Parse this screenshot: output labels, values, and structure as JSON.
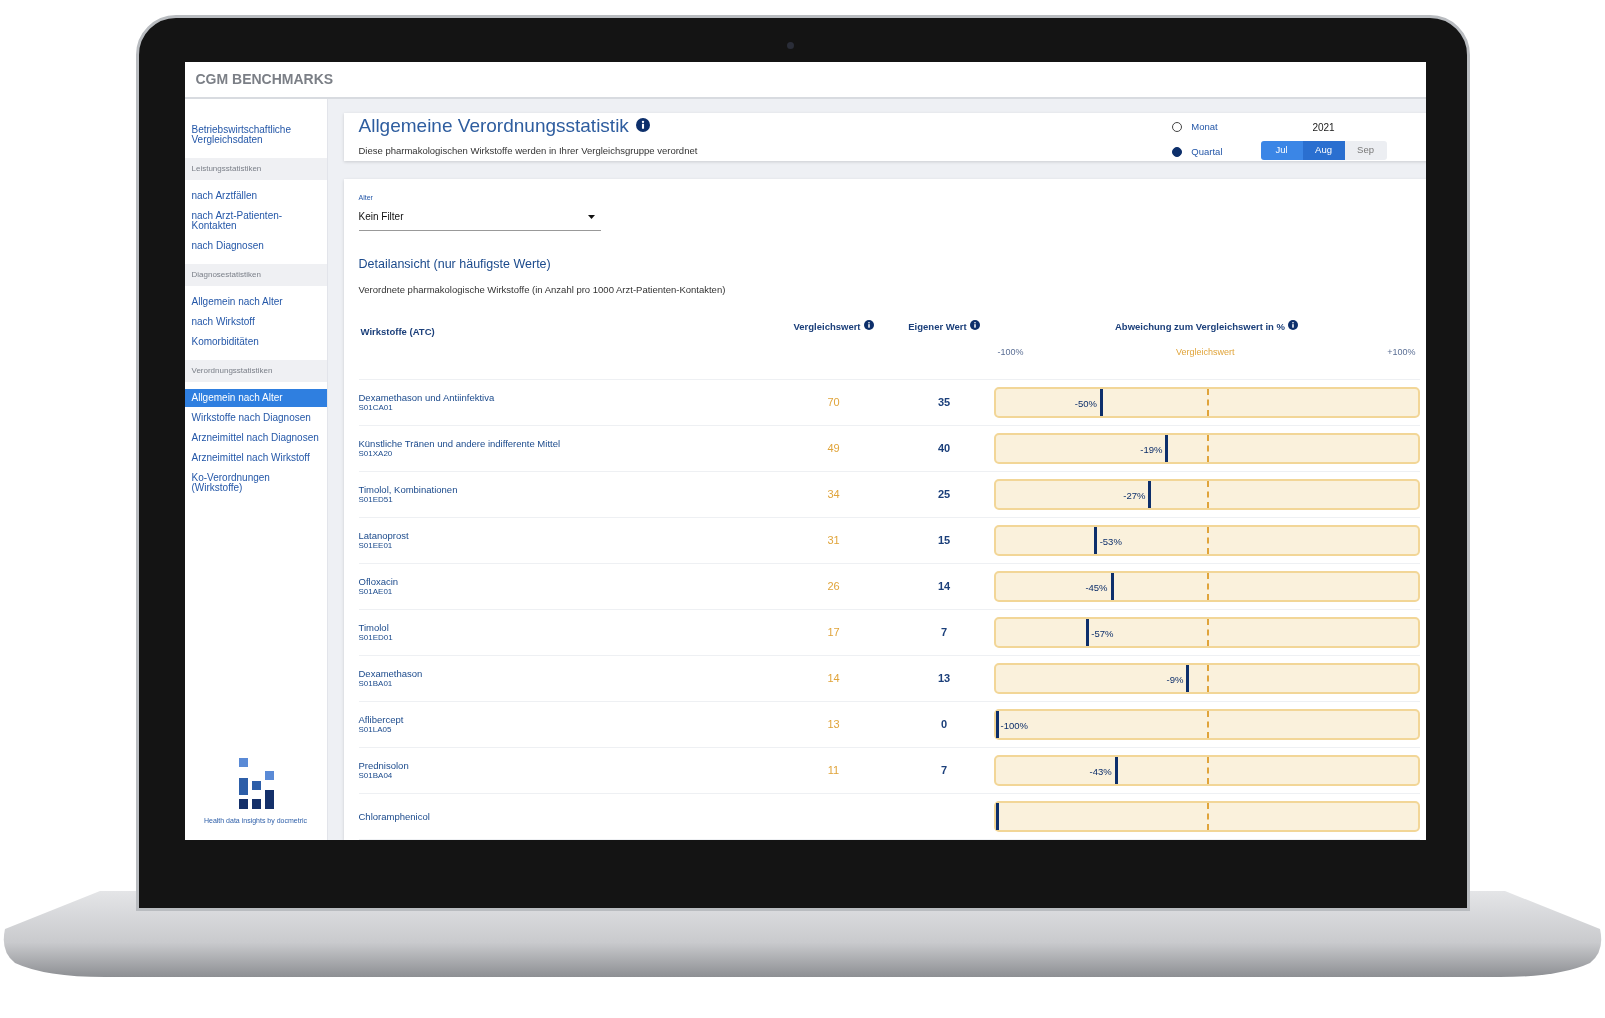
{
  "app": {
    "title": "CGM BENCHMARKS"
  },
  "sidebar": {
    "items": [
      {
        "kind": "link",
        "label": "Betriebswirtschaftliche Vergleichsdaten",
        "selected": false
      },
      {
        "kind": "section",
        "label": "Leistungsstatistiken"
      },
      {
        "kind": "link",
        "label": "nach Arztfällen",
        "selected": false
      },
      {
        "kind": "link",
        "label": "nach Arzt-Patienten-Kontakten",
        "selected": false
      },
      {
        "kind": "link",
        "label": "nach Diagnosen",
        "selected": false
      },
      {
        "kind": "section",
        "label": "Diagnosestatistiken"
      },
      {
        "kind": "link",
        "label": "Allgemein nach Alter",
        "selected": false
      },
      {
        "kind": "link",
        "label": "nach Wirkstoff",
        "selected": false
      },
      {
        "kind": "link",
        "label": "Komorbiditäten",
        "selected": false
      },
      {
        "kind": "section",
        "label": "Verordnungsstatistiken"
      },
      {
        "kind": "link",
        "label": "Allgemein nach Alter",
        "selected": true
      },
      {
        "kind": "link",
        "label": "Wirkstoffe nach Diagnosen",
        "selected": false
      },
      {
        "kind": "link",
        "label": "Arzneimittel nach Diagnosen",
        "selected": false
      },
      {
        "kind": "link",
        "label": "Arzneimittel nach Wirkstoff",
        "selected": false
      },
      {
        "kind": "link",
        "label": "Ko-Verordnungen (Wirkstoffe)",
        "selected": false
      }
    ],
    "footer": "Health data insights by docmetric"
  },
  "header": {
    "title": "Allgemeine Verordnungsstatistik",
    "subtitle": "Diese pharmakologischen Wirkstoffe werden in Ihrer Vergleichsgruppe verordnet",
    "period_options": [
      {
        "label": "Monat",
        "selected": false
      },
      {
        "label": "Quartal",
        "selected": true
      }
    ],
    "year": "2021",
    "months": [
      {
        "label": "Jul",
        "selected": true
      },
      {
        "label": "Aug",
        "selected": true
      },
      {
        "label": "Sep",
        "selected": false
      }
    ]
  },
  "filter": {
    "label": "Alter",
    "value": "Kein Filter"
  },
  "detail": {
    "title": "Detailansicht (nur häufigste Werte)",
    "subtitle": "Verordnete pharmakologische Wirkstoffe (in Anzahl pro 1000 Arzt-Patienten-Kontakten)"
  },
  "table": {
    "columns": [
      "Wirkstoffe (ATC)",
      "Vergleichswert",
      "Eigener Wert",
      "Abweichung zum Vergleichswert in %"
    ],
    "axis": {
      "min": "-100%",
      "center": "Vergleichswert",
      "max": "+100%"
    },
    "rows": [
      {
        "name": "Dexamethason und Antiinfektiva",
        "code": "S01CA01",
        "reference": "70",
        "own": "35",
        "deviation": "-50%",
        "level": 0.25
      },
      {
        "name": "Künstliche Tränen und andere indifferente Mittel",
        "code": "S01XA20",
        "reference": "49",
        "own": "40",
        "deviation": "-19%",
        "level": 0.405
      },
      {
        "name": "Timolol, Kombinationen",
        "code": "S01ED51",
        "reference": "34",
        "own": "25",
        "deviation": "-27%",
        "level": 0.365
      },
      {
        "name": "Latanoprost",
        "code": "S01EE01",
        "reference": "31",
        "own": "15",
        "deviation": "-53%",
        "level": 0.235
      },
      {
        "name": "Ofloxacin",
        "code": "S01AE01",
        "reference": "26",
        "own": "14",
        "deviation": "-45%",
        "level": 0.275
      },
      {
        "name": "Timolol",
        "code": "S01ED01",
        "reference": "17",
        "own": "7",
        "deviation": "-57%",
        "level": 0.215
      },
      {
        "name": "Dexamethason",
        "code": "S01BA01",
        "reference": "14",
        "own": "13",
        "deviation": "-9%",
        "level": 0.455
      },
      {
        "name": "Aflibercept",
        "code": "S01LA05",
        "reference": "13",
        "own": "0",
        "deviation": "-100%",
        "level": 0
      },
      {
        "name": "Prednisolon",
        "code": "S01BA04",
        "reference": "11",
        "own": "7",
        "deviation": "-43%",
        "level": 0.285
      },
      {
        "name": "Chloramphenicol",
        "level": 0
      }
    ]
  }
}
